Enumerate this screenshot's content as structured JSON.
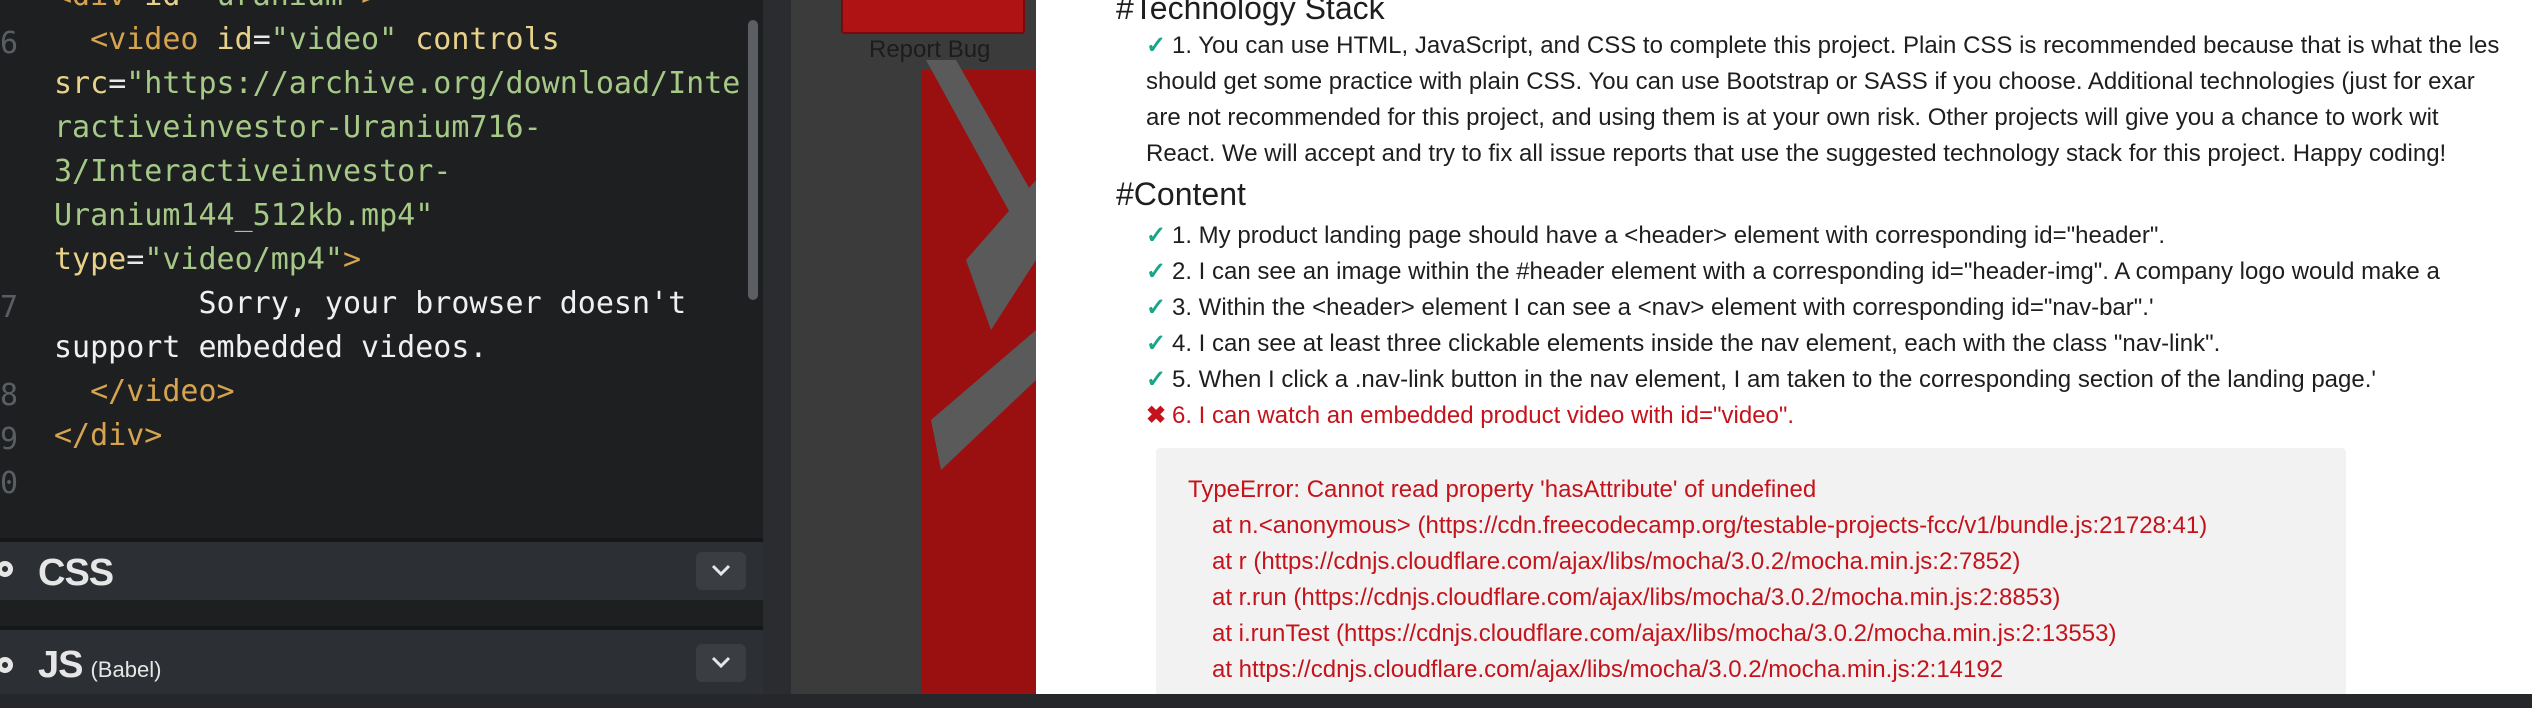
{
  "editor": {
    "line_numbers": [
      "6",
      "7",
      "8",
      "9",
      "0"
    ],
    "code": {
      "l1_tag": "<div",
      "l1_attr": " id=",
      "l1_str": "\"uranium\"",
      "l1_tag2": ">",
      "l2_tag": "<video",
      "l2_attr1": " id",
      "l2_eq1": "=",
      "l2_str1": "\"video\"",
      "l2_attr2": " controls",
      "l3_attr": "src",
      "l3_eq": "=",
      "l3_str": "\"https://archive.org/download/Inte",
      "l4_str": "ractiveinvestor-Uranium716-",
      "l5_str": "3/Interactiveinvestor-",
      "l6_str": "Uranium144_512kb.mp4\"",
      "l7_attr": "type",
      "l7_eq": "=",
      "l7_str": "\"video/mp4\"",
      "l7_tag": ">",
      "l8_text": "        Sorry, your browser doesn't",
      "l9_text": "support embedded videos.",
      "l10_tag": "  </video>",
      "l11_tag": "</div>"
    },
    "css_panel": {
      "title": "CSS"
    },
    "js_panel": {
      "title": "JS",
      "subtitle": "(Babel)"
    }
  },
  "preview": {
    "report_bug_label": "Report Bug"
  },
  "results": {
    "section_tech": "#Technology Stack",
    "tech_lines": [
      "1. You can use HTML, JavaScript, and CSS to complete this project. Plain CSS is recommended because that is what the les",
      "should get some practice with plain CSS. You can use Bootstrap or SASS if you choose. Additional technologies (just for exar",
      "are not recommended for this project, and using them is at your own risk. Other projects will give you a chance to work wit",
      "React. We will accept and try to fix all issue reports that use the suggested technology stack for this project. Happy coding!"
    ],
    "section_content": "#Content",
    "tests": [
      {
        "status": "pass",
        "mark": "✓",
        "text": "1. My product landing page should have a <header> element with corresponding id=\"header\"."
      },
      {
        "status": "pass",
        "mark": "✓",
        "text": "2. I can see an image within the #header element with a corresponding id=\"header-img\". A company logo would make a"
      },
      {
        "status": "pass",
        "mark": "✓",
        "text": "3. Within the <header> element I can see a <nav> element with corresponding id=\"nav-bar\".'"
      },
      {
        "status": "pass",
        "mark": "✓",
        "text": "4. I can see at least three clickable elements inside the nav element, each with the class \"nav-link\"."
      },
      {
        "status": "pass",
        "mark": "✓",
        "text": "5. When I click a .nav-link button in the nav element, I am taken to the corresponding section of the landing page.'"
      },
      {
        "status": "fail",
        "mark": "✖",
        "text": "6. I can watch an embedded product video with id=\"video\"."
      }
    ],
    "error": {
      "message": "TypeError: Cannot read property 'hasAttribute' of undefined",
      "stack": [
        "at n.<anonymous> (https://cdn.freecodecamp.org/testable-projects-fcc/v1/bundle.js:21728:41)",
        "at r (https://cdnjs.cloudflare.com/ajax/libs/mocha/3.0.2/mocha.min.js:2:7852)",
        "at r.run (https://cdnjs.cloudflare.com/ajax/libs/mocha/3.0.2/mocha.min.js:2:8853)",
        "at i.runTest (https://cdnjs.cloudflare.com/ajax/libs/mocha/3.0.2/mocha.min.js:2:13553)",
        "at https://cdnjs.cloudflare.com/ajax/libs/mocha/3.0.2/mocha.min.js:2:14192"
      ]
    }
  }
}
